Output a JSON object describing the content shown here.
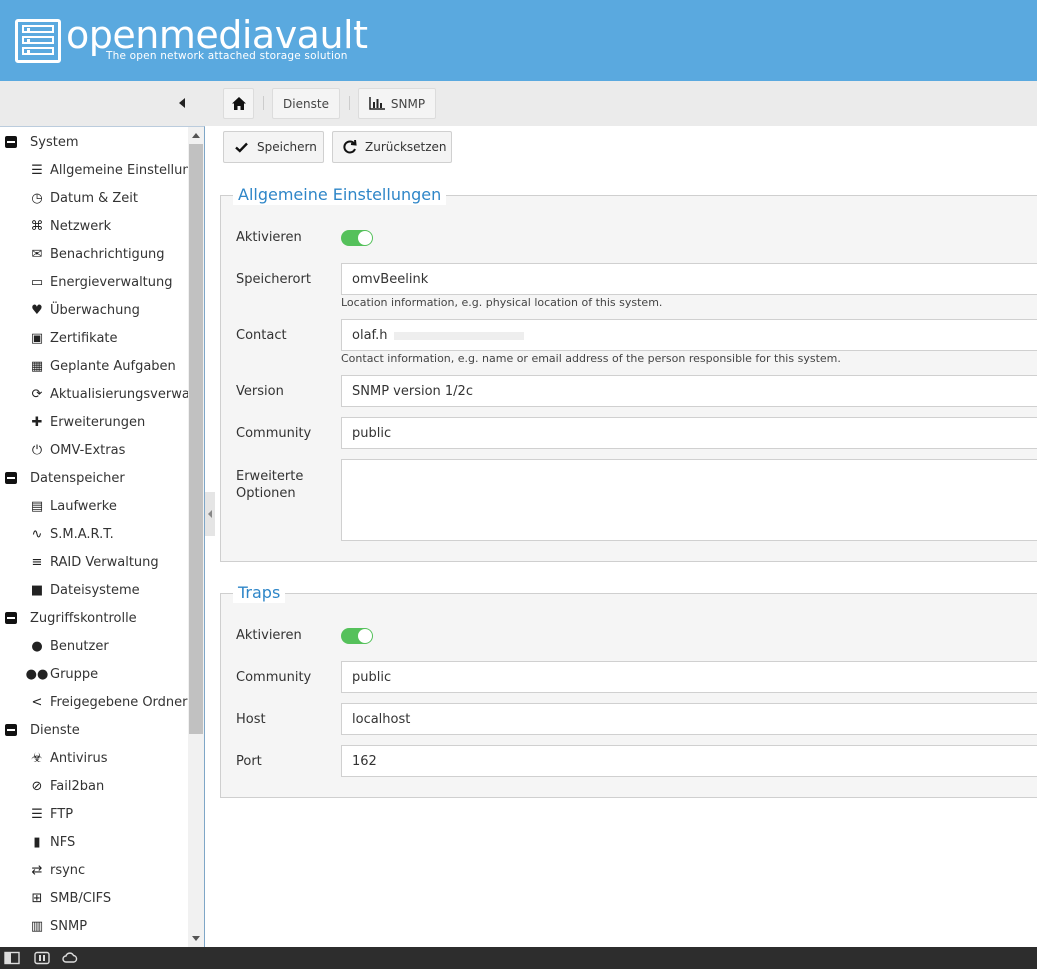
{
  "app": {
    "title": "openmediavault",
    "subtitle": "The open network attached storage solution"
  },
  "breadcrumb": {
    "home_icon": "home-icon",
    "items": [
      "Dienste",
      "SNMP"
    ]
  },
  "toolbar": {
    "save_label": "Speichern",
    "reset_label": "Zurücksetzen"
  },
  "sidebar": {
    "items": [
      {
        "label": "System",
        "type": "group"
      },
      {
        "label": "Allgemeine Einstellungen",
        "icon": "sliders-icon"
      },
      {
        "label": "Datum & Zeit",
        "icon": "clock-icon"
      },
      {
        "label": "Netzwerk",
        "icon": "network-icon"
      },
      {
        "label": "Benachrichtigung",
        "icon": "mail-icon"
      },
      {
        "label": "Energieverwaltung",
        "icon": "battery-icon"
      },
      {
        "label": "Überwachung",
        "icon": "heart-pulse-icon"
      },
      {
        "label": "Zertifikate",
        "icon": "certificate-icon"
      },
      {
        "label": "Geplante Aufgaben",
        "icon": "calendar-clock-icon"
      },
      {
        "label": "Aktualisierungsverwaltung",
        "icon": "refresh-icon"
      },
      {
        "label": "Erweiterungen",
        "icon": "puzzle-icon"
      },
      {
        "label": "OMV-Extras",
        "icon": "plug-icon"
      },
      {
        "label": "Datenspeicher",
        "type": "group"
      },
      {
        "label": "Laufwerke",
        "icon": "harddisk-icon"
      },
      {
        "label": "S.M.A.R.T.",
        "icon": "pulse-icon"
      },
      {
        "label": "RAID Verwaltung",
        "icon": "database-icon"
      },
      {
        "label": "Dateisysteme",
        "icon": "folders-icon"
      },
      {
        "label": "Zugriffskontrolle",
        "type": "group"
      },
      {
        "label": "Benutzer",
        "icon": "user-icon"
      },
      {
        "label": "Gruppe",
        "icon": "users-icon"
      },
      {
        "label": "Freigegebene Ordner",
        "icon": "share-icon"
      },
      {
        "label": "Dienste",
        "type": "group"
      },
      {
        "label": "Antivirus",
        "icon": "biohazard-icon"
      },
      {
        "label": "Fail2ban",
        "icon": "ban-icon"
      },
      {
        "label": "FTP",
        "icon": "server-icon"
      },
      {
        "label": "NFS",
        "icon": "monitor-icon"
      },
      {
        "label": "rsync",
        "icon": "sync-computers-icon"
      },
      {
        "label": "SMB/CIFS",
        "icon": "windows-icon"
      },
      {
        "label": "SNMP",
        "icon": "chart-icon"
      }
    ]
  },
  "general": {
    "legend": "Allgemeine Einstellungen",
    "enable_label": "Aktivieren",
    "enabled": true,
    "location_label": "Speicherort",
    "location_value": "omvBeelink",
    "location_help": "Location information, e.g. physical location of this system.",
    "contact_label": "Contact",
    "contact_value": "olaf.h",
    "contact_help": "Contact information, e.g. name or email address of the person responsible for this system.",
    "version_label": "Version",
    "version_value": "SNMP version 1/2c",
    "community_label": "Community",
    "community_value": "public",
    "extra_label": "Erweiterte Optionen",
    "extra_value": ""
  },
  "traps": {
    "legend": "Traps",
    "enable_label": "Aktivieren",
    "enabled": true,
    "community_label": "Community",
    "community_value": "public",
    "host_label": "Host",
    "host_value": "localhost",
    "port_label": "Port",
    "port_value": "162"
  },
  "colors": {
    "header": "#5aa9df",
    "accent": "#2e86c8",
    "toggle_on": "#55c15b"
  }
}
